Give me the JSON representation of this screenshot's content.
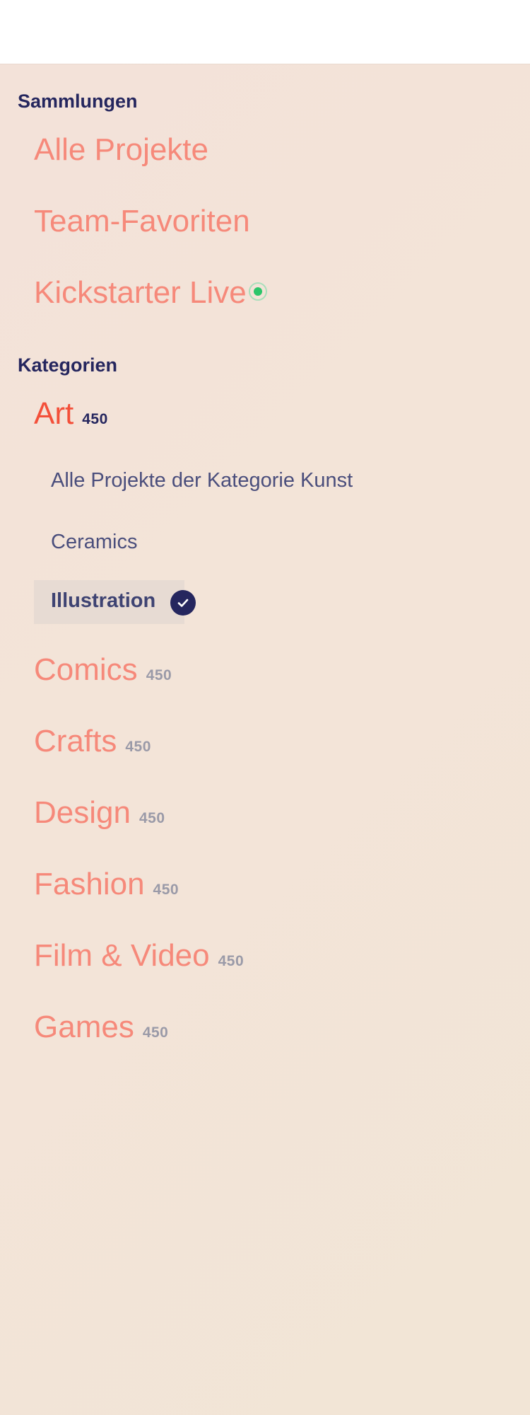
{
  "collections": {
    "heading": "Sammlungen",
    "items": [
      {
        "label": "Alle Projekte"
      },
      {
        "label": "Team-Favoriten"
      },
      {
        "label": "Kickstarter Live"
      }
    ]
  },
  "categories": {
    "heading": "Kategorien",
    "art": {
      "label": "Art",
      "count": "450",
      "subitems": [
        {
          "label": "Alle Projekte der Kategorie Kunst"
        },
        {
          "label": "Ceramics"
        },
        {
          "label": "Illustration",
          "selected": true
        }
      ]
    },
    "items": [
      {
        "label": "Comics",
        "count": "450"
      },
      {
        "label": "Crafts",
        "count": "450"
      },
      {
        "label": "Design",
        "count": "450"
      },
      {
        "label": "Fashion",
        "count": "450"
      },
      {
        "label": "Film & Video",
        "count": "450"
      },
      {
        "label": "Games",
        "count": "450"
      }
    ]
  },
  "colors": {
    "heading": "#25265e",
    "link": "#f6897a",
    "link_active": "#f3503a",
    "count": "#9a9aa8",
    "live_dot": "#2bc56a",
    "selected_bg": "#e7dbd3"
  },
  "icons": {
    "live": "live-status-icon",
    "selected": "check-icon"
  }
}
